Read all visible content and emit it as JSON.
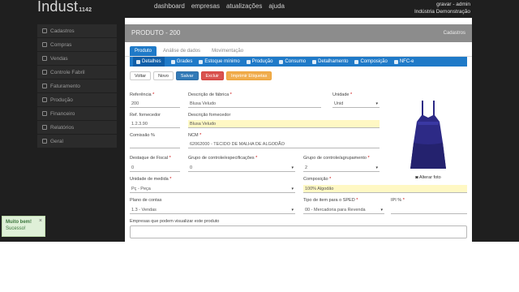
{
  "app": {
    "brand": "Indust",
    "brand_suffix": "1142"
  },
  "topnav": [
    "dashboard",
    "empresas",
    "atualizações",
    "ajuda"
  ],
  "user": {
    "name": "gravar - admin",
    "line2": "Indústria Demonstração"
  },
  "sidebar": {
    "items": [
      {
        "label": "Cadastros"
      },
      {
        "label": "Compras"
      },
      {
        "label": "Vendas"
      },
      {
        "label": "Controle Fabril"
      },
      {
        "label": "Faturamento"
      },
      {
        "label": "Produção"
      },
      {
        "label": "Financeiro"
      },
      {
        "label": "Relatórios"
      },
      {
        "label": "Geral"
      }
    ]
  },
  "toast": {
    "title": "Muito bem!",
    "message": "Sucesso!"
  },
  "page": {
    "title": "PRODUTO - 200",
    "back": "Cadastros"
  },
  "tabs": [
    "Produto",
    "Análise de dados",
    "Movimentação"
  ],
  "subtabs": [
    "Detalhes",
    "Grades",
    "Estoque mínimo",
    "Produção",
    "Consumo",
    "Detalhamento",
    "Composição",
    "NFC-e"
  ],
  "toolbar": {
    "back": "Voltar",
    "new": "Novo",
    "save": "Salvar",
    "delete": "Excluir",
    "print": "Imprimir Etiquetas"
  },
  "form": {
    "ref_label": "Referência",
    "ref_value": "200",
    "desc_label": "Descrição de fábrica",
    "desc_value": "Blusa Veludo",
    "unit_label": "Unidade",
    "unit_value": "Unid",
    "ref_client_label": "Ref. fornecedor",
    "ref_client_value": "1.2.3.90",
    "desc_client_label": "Descrição fornecedor",
    "desc_client_value": "Blusa Veludo",
    "commission_label": "Comissão %",
    "ncm_label": "NCM",
    "ncm_value": "62062000 - TECIDO DE MALHA DE ALGODÃO",
    "fiscal_label": "Destaque de Fiscal",
    "fiscal_value": "0",
    "cfop_label": "Grupo de controle/especificações",
    "cfop_value": "0",
    "icms_label": "Grupo de controle/agrupamento",
    "icms_value": "2",
    "unit_med_label": "Unidade de medida",
    "unit_med_value": "Pç - Peça",
    "composition_label": "Composição",
    "composition_value": "100% Algodão",
    "seg_label": "Plano de contas",
    "seg_value": "1.3 - Vendas",
    "sped_label": "Tipo de item para o SPED",
    "sped_value": "00 - Mercadoria para Revenda",
    "ipi_label": "IPI %",
    "obs_label": "Empresas que podem visualizar este produto"
  },
  "photo": {
    "button": "Alterar foto"
  },
  "colors": {
    "accent": "#1f7ac8",
    "dark": "#1f1f1f",
    "field_highlight": "#fff8c4",
    "garment": "#2d2a86"
  }
}
